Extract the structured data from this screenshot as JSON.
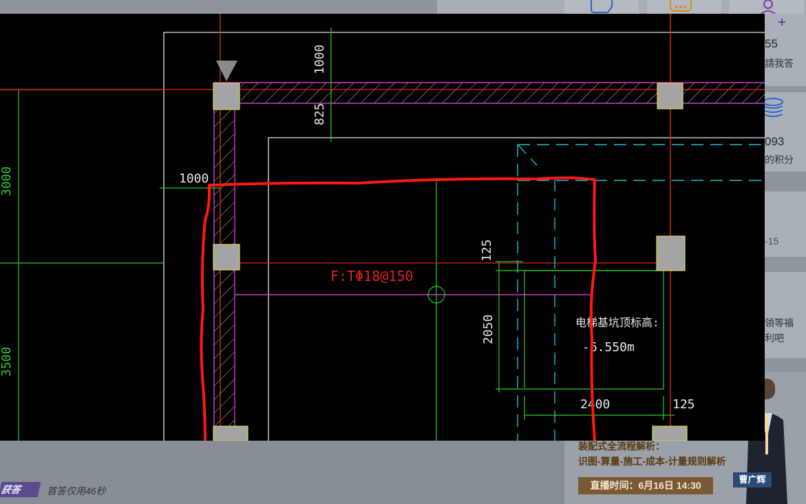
{
  "background_page": {
    "top_right_stats": {
      "answers_count": "55",
      "answers_label": "請我答",
      "points_count": "093",
      "points_label": "的积分",
      "date_fragment": "-15",
      "welfare_label_1": "領等福",
      "welfare_label_2": "利吧"
    },
    "answer_badge": "获答",
    "first_answer_time": "首答仅用46秒",
    "ad": {
      "title": "装配式全流程解析：",
      "subtitle": "识图-算量-施工-成本-计量规则解析",
      "live_time": "直播时间：6月16日 14:30",
      "presenter": "曹广辉"
    }
  },
  "cad": {
    "dim_top_1000": "1000",
    "dim_825": "825",
    "dim_left_1000": "1000",
    "dim_left_3000": "3000",
    "dim_left_3500": "3500",
    "rebar_label": "F:TΦ18@150",
    "dim_125_top": "125",
    "dim_2050": "2050",
    "pit_label_1": "电梯基坑顶标高:",
    "pit_label_2": "-6.550m",
    "dim_2400": "2400",
    "dim_125_bottom": "125"
  }
}
